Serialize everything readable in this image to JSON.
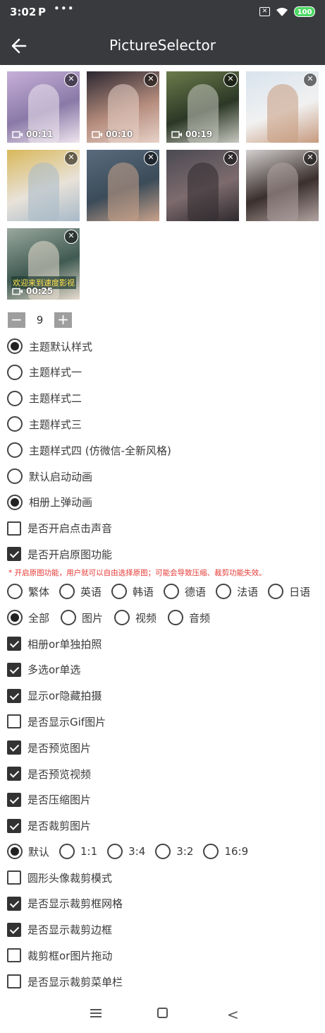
{
  "status_bar": {
    "time": "3:02",
    "app_indicator": "P",
    "more_dots": "•••",
    "battery": "100",
    "icons": [
      "sim-x-icon",
      "wifi-icon",
      "battery-icon"
    ]
  },
  "header": {
    "title": "PictureSelector",
    "back_icon": "arrow-left-icon"
  },
  "media": [
    {
      "duration": "00:11",
      "type": "video",
      "palette": [
        "#c7b0d8",
        "#8a79a8",
        "#efe6ee"
      ]
    },
    {
      "duration": "00:10",
      "type": "video",
      "palette": [
        "#2b2730",
        "#b48b7c",
        "#e8d2c8"
      ]
    },
    {
      "duration": "00:19",
      "type": "video",
      "palette": [
        "#6b7c4b",
        "#2c3826",
        "#c7c8c0"
      ]
    },
    {
      "duration": "",
      "type": "image",
      "palette": [
        "#d8e3ee",
        "#f1f1f1",
        "#c79a7e"
      ]
    },
    {
      "duration": "",
      "type": "image",
      "palette": [
        "#d9b85a",
        "#e8e2d9",
        "#a7b9c8"
      ]
    },
    {
      "duration": "",
      "type": "image",
      "palette": [
        "#5a6b7e",
        "#3b4b58",
        "#c9a28b"
      ]
    },
    {
      "duration": "",
      "type": "image",
      "palette": [
        "#4b4a52",
        "#7d6b6e",
        "#2f2a2e"
      ]
    },
    {
      "duration": "",
      "type": "image",
      "palette": [
        "#d3d0cf",
        "#3a2f2d",
        "#b1a3a0"
      ]
    },
    {
      "duration": "00:25",
      "type": "video",
      "palette": [
        "#9aa89e",
        "#3f5a52",
        "#e8ddcf"
      ],
      "caption": "欢迎来到速度影视"
    }
  ],
  "stepper": {
    "minus": "−",
    "value": "9",
    "plus": "+"
  },
  "themes": [
    {
      "label": "主题默认样式",
      "selected": true
    },
    {
      "label": "主题样式一",
      "selected": false
    },
    {
      "label": "主题样式二",
      "selected": false
    },
    {
      "label": "主题样式三",
      "selected": false
    },
    {
      "label": "主题样式四 (仿微信-全新风格)",
      "selected": false
    }
  ],
  "animations": [
    {
      "label": "默认启动动画",
      "selected": false
    },
    {
      "label": "相册上弹动画",
      "selected": true
    }
  ],
  "sound": {
    "label": "是否开启点击声音",
    "checked": false
  },
  "original": {
    "label": "是否开启原图功能",
    "checked": true
  },
  "original_note": "* 开启原图功能，用户就可以自由选择原图；可能会导致压缩、裁剪功能失效。",
  "languages": [
    {
      "label": "繁体",
      "selected": false
    },
    {
      "label": "英语",
      "selected": false
    },
    {
      "label": "韩语",
      "selected": false
    },
    {
      "label": "德语",
      "selected": false
    },
    {
      "label": "法语",
      "selected": false
    },
    {
      "label": "日语",
      "selected": false
    }
  ],
  "media_types": [
    {
      "label": "全部",
      "selected": true
    },
    {
      "label": "图片",
      "selected": false
    },
    {
      "label": "视频",
      "selected": false
    },
    {
      "label": "音频",
      "selected": false
    }
  ],
  "options_a": [
    {
      "label": "相册or单独拍照",
      "checked": true
    },
    {
      "label": "多选or单选",
      "checked": true
    },
    {
      "label": "显示or隐藏拍摄",
      "checked": true
    },
    {
      "label": "是否显示Gif图片",
      "checked": false
    },
    {
      "label": "是否预览图片",
      "checked": true
    },
    {
      "label": "是否预览视频",
      "checked": true
    },
    {
      "label": "是否压缩图片",
      "checked": true
    },
    {
      "label": "是否裁剪图片",
      "checked": true
    }
  ],
  "ratios": [
    {
      "label": "默认",
      "selected": true
    },
    {
      "label": "1:1",
      "selected": false
    },
    {
      "label": "3:4",
      "selected": false
    },
    {
      "label": "3:2",
      "selected": false
    },
    {
      "label": "16:9",
      "selected": false
    }
  ],
  "options_b": [
    {
      "label": "圆形头像裁剪模式",
      "checked": false
    },
    {
      "label": "是否显示裁剪框网格",
      "checked": true
    },
    {
      "label": "是否显示裁剪边框",
      "checked": true
    },
    {
      "label": "裁剪框or图片拖动",
      "checked": false
    },
    {
      "label": "是否显示裁剪菜单栏",
      "checked": false
    }
  ],
  "nav": {
    "icons": [
      "menu-icon",
      "home-icon",
      "back-icon"
    ]
  }
}
